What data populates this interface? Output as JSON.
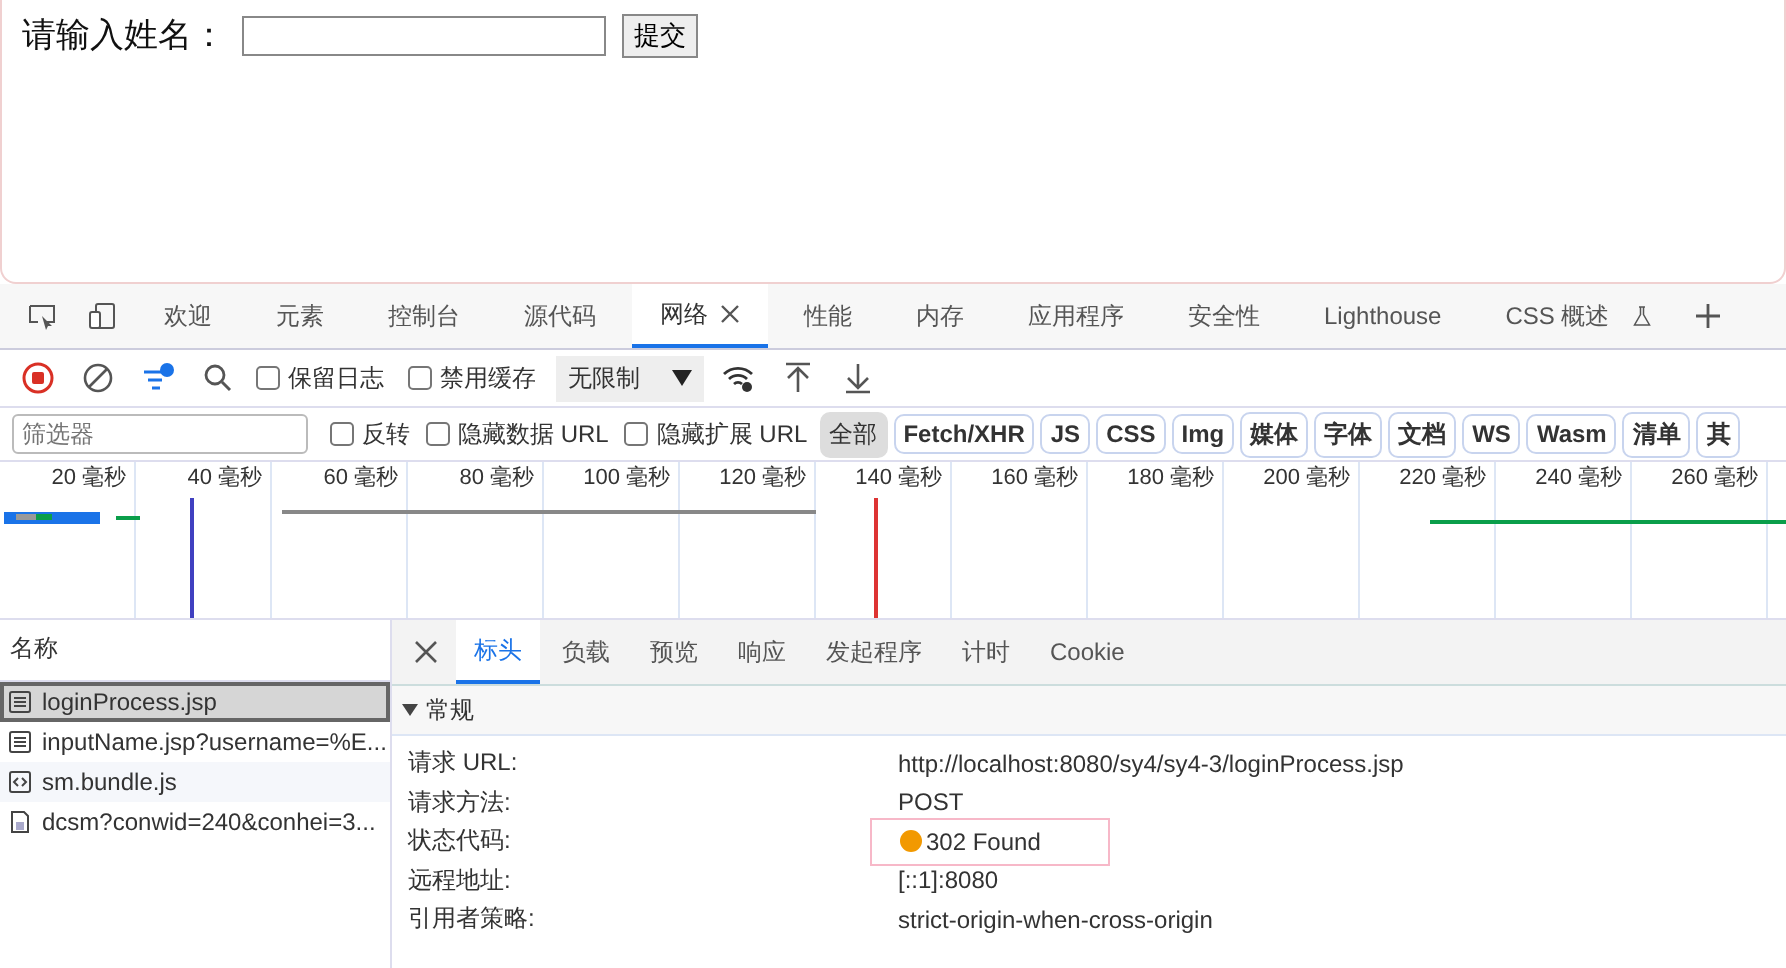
{
  "page": {
    "label": "请输入姓名：",
    "submit": "提交"
  },
  "tabs": [
    {
      "label": "欢迎",
      "selected": false
    },
    {
      "label": "元素",
      "selected": false
    },
    {
      "label": "控制台",
      "selected": false
    },
    {
      "label": "源代码",
      "selected": false
    },
    {
      "label": "网络",
      "selected": true
    },
    {
      "label": "性能",
      "selected": false
    },
    {
      "label": "内存",
      "selected": false
    },
    {
      "label": "应用程序",
      "selected": false
    },
    {
      "label": "安全性",
      "selected": false
    },
    {
      "label": "Lighthouse",
      "selected": false
    },
    {
      "label": "CSS 概述",
      "selected": false
    }
  ],
  "toolbar": {
    "recording": true,
    "preserve_log": {
      "label": "保留日志",
      "checked": false
    },
    "disable_cache": {
      "label": "禁用缓存",
      "checked": false
    },
    "throttle": "无限制"
  },
  "filter": {
    "placeholder": "筛选器",
    "options": [
      {
        "label": "反转",
        "checked": false
      },
      {
        "label": "隐藏数据 URL",
        "checked": false
      },
      {
        "label": "隐藏扩展 URL",
        "checked": false
      }
    ],
    "types": [
      {
        "label": "全部",
        "selected": true
      },
      {
        "label": "Fetch/XHR",
        "selected": false
      },
      {
        "label": "JS",
        "selected": false
      },
      {
        "label": "CSS",
        "selected": false
      },
      {
        "label": "Img",
        "selected": false
      },
      {
        "label": "媒体",
        "selected": false
      },
      {
        "label": "字体",
        "selected": false
      },
      {
        "label": "文档",
        "selected": false
      },
      {
        "label": "WS",
        "selected": false
      },
      {
        "label": "Wasm",
        "selected": false
      },
      {
        "label": "清单",
        "selected": false
      },
      {
        "label": "其",
        "selected": false
      }
    ]
  },
  "timeline": {
    "ticks": [
      "20  毫秒",
      "40  毫秒",
      "60  毫秒",
      "80  毫秒",
      "100  毫秒",
      "120  毫秒",
      "140  毫秒",
      "160  毫秒",
      "180  毫秒",
      "200  毫秒",
      "220  毫秒",
      "240  毫秒",
      "260  毫秒"
    ]
  },
  "requests": {
    "heading": "名称",
    "rows": [
      {
        "name": "loginProcess.jsp",
        "kind": "document",
        "selected": true
      },
      {
        "name": "inputName.jsp?username=%E...",
        "kind": "document",
        "selected": false
      },
      {
        "name": "sm.bundle.js",
        "kind": "script",
        "selected": false
      },
      {
        "name": "dcsm?conwid=240&conhei=3...",
        "kind": "file",
        "selected": false
      }
    ]
  },
  "details": {
    "tabs": [
      {
        "label": "标头",
        "selected": true
      },
      {
        "label": "负载",
        "selected": false
      },
      {
        "label": "预览",
        "selected": false
      },
      {
        "label": "响应",
        "selected": false
      },
      {
        "label": "发起程序",
        "selected": false
      },
      {
        "label": "计时",
        "selected": false
      },
      {
        "label": "Cookie",
        "selected": false
      }
    ],
    "section": {
      "title": "常规",
      "expanded": true
    },
    "fields": [
      {
        "label": "请求 URL:",
        "value": "http://localhost:8080/sy4/sy4-3/loginProcess.jsp"
      },
      {
        "label": "请求方法:",
        "value": "POST"
      },
      {
        "label": "状态代码:",
        "value": "302 Found",
        "color": "#f29900"
      },
      {
        "label": "远程地址:",
        "value": "[::1]:8080"
      },
      {
        "label": "引用者策略:",
        "value": "strict-origin-when-cross-origin"
      }
    ]
  }
}
